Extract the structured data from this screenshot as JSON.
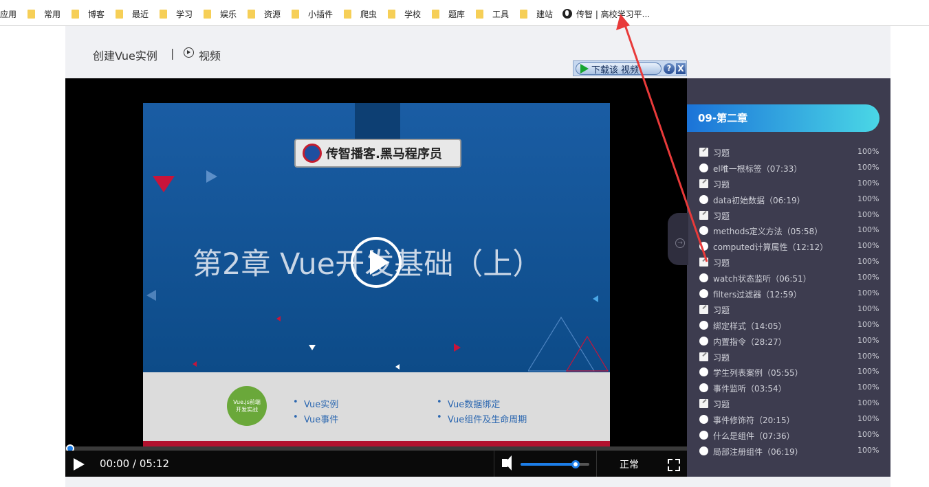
{
  "bookmarks": {
    "items": [
      {
        "label": "应用",
        "type": "apps"
      },
      {
        "label": "常用",
        "type": "folder"
      },
      {
        "label": "博客",
        "type": "folder"
      },
      {
        "label": "最近",
        "type": "folder"
      },
      {
        "label": "学习",
        "type": "folder"
      },
      {
        "label": "娱乐",
        "type": "folder"
      },
      {
        "label": "资源",
        "type": "folder"
      },
      {
        "label": "小插件",
        "type": "folder"
      },
      {
        "label": "爬虫",
        "type": "folder"
      },
      {
        "label": "学校",
        "type": "folder"
      },
      {
        "label": "题库",
        "type": "folder"
      },
      {
        "label": "工具",
        "type": "folder"
      },
      {
        "label": "建站",
        "type": "folder"
      },
      {
        "label": "传智 | 高校学习平...",
        "type": "page"
      }
    ]
  },
  "header": {
    "lesson_title": "创建Vue实例",
    "separator": "|",
    "video_label": "视频"
  },
  "download_bar": {
    "label": "下载该 视频",
    "help": "?",
    "close": "X"
  },
  "slide": {
    "logo_text": "传智播客.黑马程序员",
    "chapter_title": "第2章 Vue开发基础（上）",
    "badge_line1": "Vue.js前端",
    "badge_line2": "开发实战",
    "topics": [
      "Vue实例",
      "Vue事件",
      "Vue数据绑定",
      "Vue组件及生命周期"
    ]
  },
  "player": {
    "time": "00:00 / 05:12",
    "speed": "正常",
    "progress": 0,
    "volume": 0.8,
    "accent_color": "#1d7ee8"
  },
  "sidebar": {
    "chapter": "09-第二章",
    "lessons": [
      {
        "name": "习题",
        "type": "quiz",
        "percent": "100%"
      },
      {
        "name": "el唯一根标签（07:33）",
        "type": "video",
        "percent": "100%"
      },
      {
        "name": "习题",
        "type": "quiz",
        "percent": "100%"
      },
      {
        "name": "data初始数据（06:19）",
        "type": "video",
        "percent": "100%"
      },
      {
        "name": "习题",
        "type": "quiz",
        "percent": "100%"
      },
      {
        "name": "methods定义方法（05:58）",
        "type": "video",
        "percent": "100%"
      },
      {
        "name": "computed计算属性（12:12）",
        "type": "video",
        "percent": "100%"
      },
      {
        "name": "习题",
        "type": "quiz",
        "percent": "100%"
      },
      {
        "name": "watch状态监听（06:51）",
        "type": "video",
        "percent": "100%"
      },
      {
        "name": "filters过滤器（12:59）",
        "type": "video",
        "percent": "100%"
      },
      {
        "name": "习题",
        "type": "quiz",
        "percent": "100%"
      },
      {
        "name": "绑定样式（14:05）",
        "type": "video",
        "percent": "100%"
      },
      {
        "name": "内置指令（28:27）",
        "type": "video",
        "percent": "100%"
      },
      {
        "name": "习题",
        "type": "quiz",
        "percent": "100%"
      },
      {
        "name": "学生列表案例（05:55）",
        "type": "video",
        "percent": "100%"
      },
      {
        "name": "事件监听（03:54）",
        "type": "video",
        "percent": "100%"
      },
      {
        "name": "习题",
        "type": "quiz",
        "percent": "100%"
      },
      {
        "name": "事件修饰符（20:15）",
        "type": "video",
        "percent": "100%"
      },
      {
        "name": "什么是组件（07:36）",
        "type": "video",
        "percent": "100%"
      },
      {
        "name": "局部注册组件（06:19）",
        "type": "video",
        "percent": "100%"
      }
    ]
  }
}
